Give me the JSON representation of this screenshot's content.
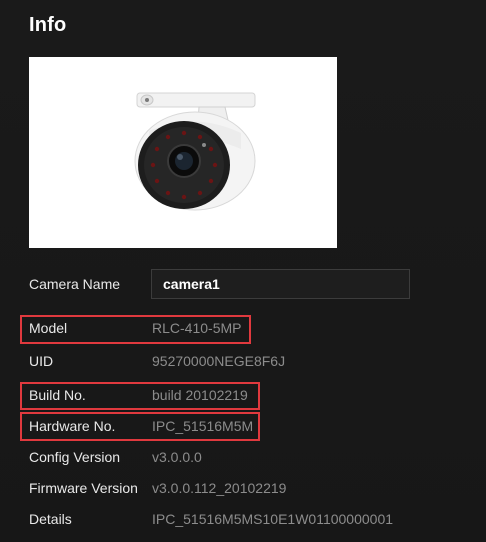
{
  "header": {
    "title": "Info"
  },
  "camera_image": {
    "icon": "security-camera-icon"
  },
  "fields": {
    "camera_name": {
      "label": "Camera Name",
      "value": "camera1"
    },
    "model": {
      "label": "Model",
      "value": "RLC-410-5MP"
    },
    "uid": {
      "label": "UID",
      "value": "95270000NEGE8F6J"
    },
    "build_no": {
      "label": "Build No.",
      "value": "build 20102219"
    },
    "hardware_no": {
      "label": "Hardware No.",
      "value": "IPC_51516M5M"
    },
    "config_version": {
      "label": "Config Version",
      "value": "v3.0.0.0"
    },
    "firmware_version": {
      "label": "Firmware Version",
      "value": "v3.0.0.112_20102219"
    },
    "details": {
      "label": "Details",
      "value": "IPC_51516M5MS10E1W01100000001"
    }
  },
  "colors": {
    "background": "#171717",
    "highlight": "#e0393e",
    "label": "#e9e9e9",
    "value": "#8c8c8c"
  }
}
